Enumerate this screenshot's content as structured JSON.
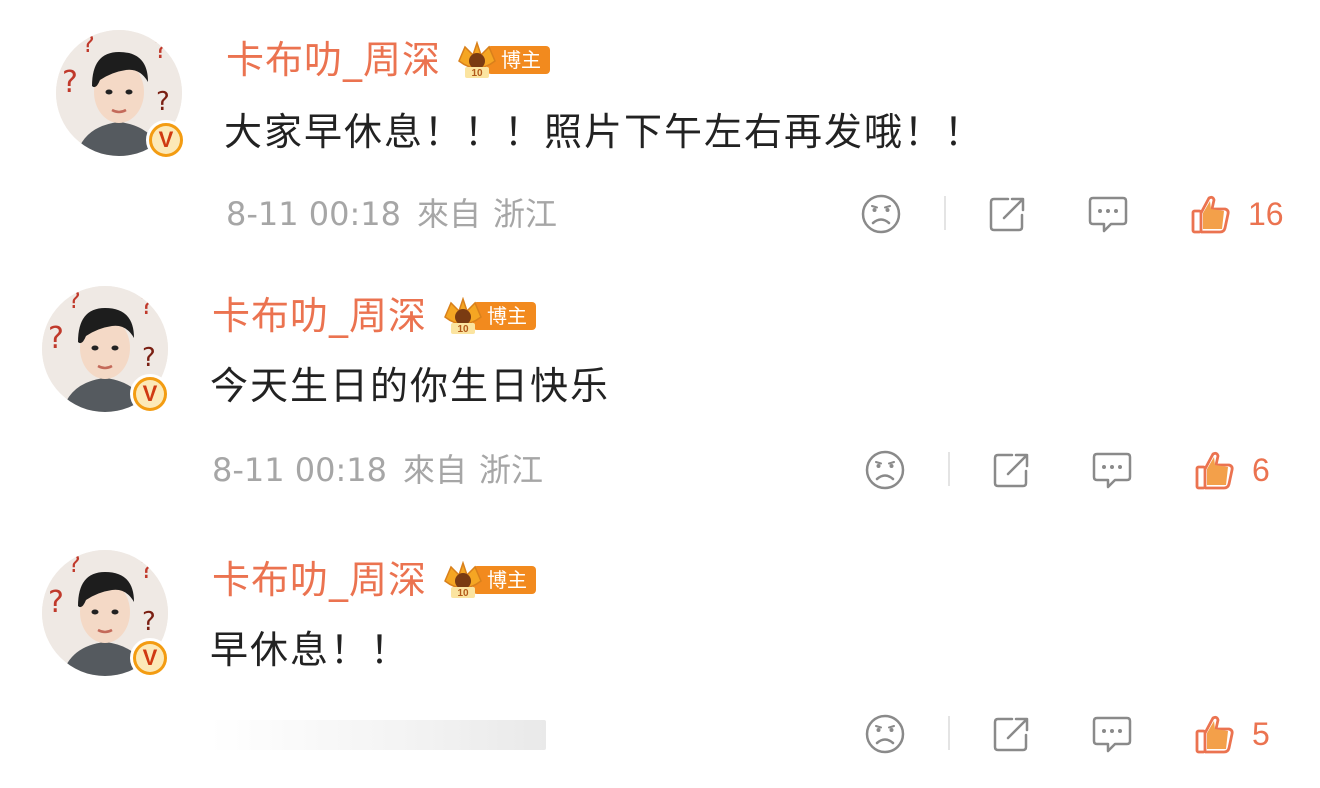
{
  "comments": [
    {
      "username": "卡布叻_周深",
      "badge_label": "博主",
      "badge_level": "10",
      "text": "大家早休息！！！照片下午左右再发哦！！",
      "meta": {
        "time": "8-11 00:18",
        "source": "來自",
        "location": "浙江"
      },
      "likes": "16"
    },
    {
      "username": "卡布叻_周深",
      "badge_label": "博主",
      "badge_level": "10",
      "text": "今天生日的你生日快乐",
      "meta": {
        "time": "8-11 00:18",
        "source": "來自",
        "location": "浙江"
      },
      "likes": "6"
    },
    {
      "username": "卡布叻_周深",
      "badge_label": "博主",
      "badge_level": "10",
      "text": "早休息！！",
      "likes": "5"
    }
  ],
  "icons": {
    "avatar": "avatar-photo",
    "verified": "verified-v-badge",
    "dislike": "sad-face-icon",
    "share": "share-icon",
    "reply": "comment-bubble-icon",
    "like": "thumbs-up-icon"
  },
  "colors": {
    "accent": "#eb7350",
    "text": "#222222",
    "meta": "#a6a6a6",
    "badge": "#f28a1e",
    "icon": "#8a8a8a"
  }
}
